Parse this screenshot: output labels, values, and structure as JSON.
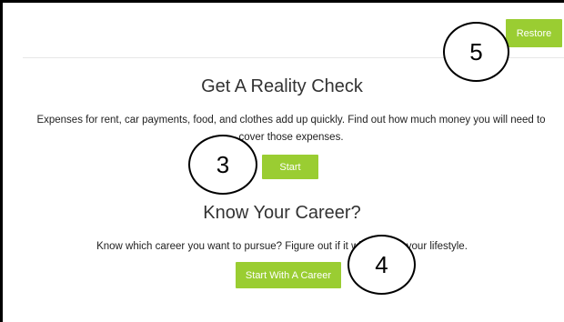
{
  "header": {
    "restore_label": "Restore"
  },
  "reality_check": {
    "title": "Get A Reality Check",
    "description": "Expenses for rent, car payments, food, and clothes add up quickly. Find out how much money you will need to cover those expenses.",
    "start_label": "Start"
  },
  "career": {
    "title": "Know Your Career?",
    "description": "Know which career you want to pursue? Figure out if it will support your lifestyle.",
    "start_label": "Start With A Career"
  },
  "callouts": {
    "three": "3",
    "four": "4",
    "five": "5"
  },
  "colors": {
    "button": "#9acd32",
    "heading": "#333333"
  }
}
